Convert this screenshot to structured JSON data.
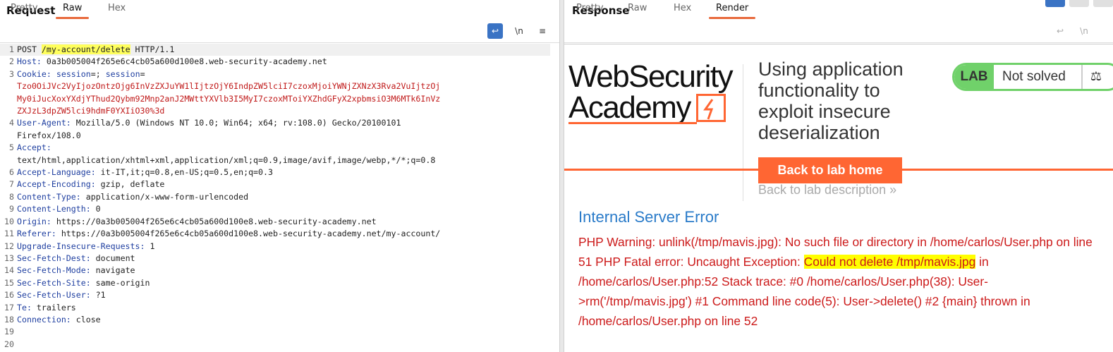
{
  "request": {
    "title": "Request",
    "tabs": [
      "Pretty",
      "Raw",
      "Hex"
    ],
    "active_tab": "Raw",
    "toolbar": {
      "newline_label": "\\n",
      "menu_label": "≡"
    },
    "lines": [
      {
        "num": "1",
        "parts": [
          {
            "t": "POST "
          },
          {
            "t": "/my-account/delete",
            "hl": true
          },
          {
            "t": " HTTP/1.1"
          }
        ]
      },
      {
        "num": "2",
        "parts": [
          {
            "t": "Host:",
            "h": true
          },
          {
            "t": " 0a3b005004f265e6c4cb05a600d100e8.web-security-academy.net"
          }
        ]
      },
      {
        "num": "3",
        "parts": [
          {
            "t": "Cookie:",
            "h": true
          },
          {
            "t": " "
          },
          {
            "t": "session",
            "h": true
          },
          {
            "t": "=; "
          },
          {
            "t": "session",
            "h": true
          },
          {
            "t": "="
          }
        ]
      },
      {
        "num": "",
        "parts": [
          {
            "t": "Tzo0OiJVc2VyIjozOntzOjg6InVzZXJuYW1lIjtzOjY6IndpZW5lciI7czoxMjoiYWNjZXNzX3Rva2VuIjtzOj",
            "c": true
          }
        ]
      },
      {
        "num": "",
        "parts": [
          {
            "t": "My0iJucXoxYXdjYThud2Qybm92Mnp2anJ2MWttYXVlb3I5MyI7czoxMToiYXZhdGFyX2xpbmsiO3M6MTk6InVz",
            "c": true
          }
        ]
      },
      {
        "num": "",
        "parts": [
          {
            "t": "ZXJzL3dpZW5lci9hdmF0YXIiO30%3d",
            "c": true
          }
        ]
      },
      {
        "num": "4",
        "parts": [
          {
            "t": "User-Agent:",
            "h": true
          },
          {
            "t": " Mozilla/5.0 (Windows NT 10.0; Win64; x64; rv:108.0) Gecko/20100101"
          }
        ]
      },
      {
        "num": "",
        "parts": [
          {
            "t": "Firefox/108.0"
          }
        ]
      },
      {
        "num": "5",
        "parts": [
          {
            "t": "Accept:",
            "h": true
          }
        ]
      },
      {
        "num": "",
        "parts": [
          {
            "t": "text/html,application/xhtml+xml,application/xml;q=0.9,image/avif,image/webp,*/*;q=0.8"
          }
        ]
      },
      {
        "num": "6",
        "parts": [
          {
            "t": "Accept-Language:",
            "h": true
          },
          {
            "t": " it-IT,it;q=0.8,en-US;q=0.5,en;q=0.3"
          }
        ]
      },
      {
        "num": "7",
        "parts": [
          {
            "t": "Accept-Encoding:",
            "h": true
          },
          {
            "t": " gzip, deflate"
          }
        ]
      },
      {
        "num": "8",
        "parts": [
          {
            "t": "Content-Type:",
            "h": true
          },
          {
            "t": " application/x-www-form-urlencoded"
          }
        ]
      },
      {
        "num": "9",
        "parts": [
          {
            "t": "Content-Length:",
            "h": true
          },
          {
            "t": " 0"
          }
        ]
      },
      {
        "num": "10",
        "parts": [
          {
            "t": "Origin:",
            "h": true
          },
          {
            "t": " https://0a3b005004f265e6c4cb05a600d100e8.web-security-academy.net"
          }
        ]
      },
      {
        "num": "11",
        "parts": [
          {
            "t": "Referer:",
            "h": true
          },
          {
            "t": " https://0a3b005004f265e6c4cb05a600d100e8.web-security-academy.net/my-account/"
          }
        ]
      },
      {
        "num": "12",
        "parts": [
          {
            "t": "Upgrade-Insecure-Requests:",
            "h": true
          },
          {
            "t": " 1"
          }
        ]
      },
      {
        "num": "13",
        "parts": [
          {
            "t": "Sec-Fetch-Dest:",
            "h": true
          },
          {
            "t": " document"
          }
        ]
      },
      {
        "num": "14",
        "parts": [
          {
            "t": "Sec-Fetch-Mode:",
            "h": true
          },
          {
            "t": " navigate"
          }
        ]
      },
      {
        "num": "15",
        "parts": [
          {
            "t": "Sec-Fetch-Site:",
            "h": true
          },
          {
            "t": " same-origin"
          }
        ]
      },
      {
        "num": "16",
        "parts": [
          {
            "t": "Sec-Fetch-User:",
            "h": true
          },
          {
            "t": " ?1"
          }
        ]
      },
      {
        "num": "17",
        "parts": [
          {
            "t": "Te:",
            "h": true
          },
          {
            "t": " trailers"
          }
        ]
      },
      {
        "num": "18",
        "parts": [
          {
            "t": "Connection:",
            "h": true
          },
          {
            "t": " close"
          }
        ]
      },
      {
        "num": "19",
        "parts": []
      },
      {
        "num": "20",
        "parts": []
      }
    ]
  },
  "response": {
    "title": "Response",
    "tabs": [
      "Pretty",
      "Raw",
      "Hex",
      "Render"
    ],
    "active_tab": "Render",
    "toolbar": {
      "newline_label": "\\n"
    },
    "render": {
      "logo_line1": "WebSecurity",
      "logo_line2": "Academy",
      "lab_title": "Using application functionality to exploit insecure deserialization",
      "lab_badge": "LAB",
      "lab_status": "Not solved",
      "back_home": "Back to lab home",
      "back_description": "Back to lab description",
      "back_description_chevron": "»",
      "error_title": "Internal Server Error",
      "error_text_1": " PHP Warning: unlink(/tmp/mavis.jpg): No such file or directory in /home/carlos/User.php on line 51 PHP Fatal error: Uncaught Exception: ",
      "error_highlight": "Could not delete /tmp/mavis.jpg",
      "error_text_2": " in /home/carlos/User.php:52 Stack trace: #0 /home/carlos/User.php(38): User->rm('/tmp/mavis.jpg') #1 Command line code(5): User->delete() #2 {main} thrown in /home/carlos/User.php on line 52"
    }
  },
  "colors": {
    "accent": "#e8693b",
    "header_name": "#1f3fa0",
    "cookie": "#c01919",
    "lab_green": "#70d16a",
    "error_red": "#cc1a1a",
    "error_blue": "#2a7bc9",
    "brand_orange": "#ff6633"
  }
}
